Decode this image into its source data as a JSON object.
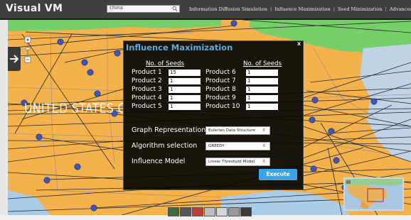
{
  "app": {
    "title": "Visual VM"
  },
  "search": {
    "value": "china"
  },
  "nav": {
    "items": [
      "Information Diffusion Simulation",
      "Influence Maximization",
      "Seed Minimization",
      "Advanced Search",
      ">"
    ]
  },
  "map": {
    "watermark": "UNITED STATES OF"
  },
  "modal": {
    "title": "Influence Maximization",
    "close": "x",
    "seeds_header": "No. of Seeds",
    "products_left": [
      {
        "label": "Product 1",
        "value": "15"
      },
      {
        "label": "Product 2",
        "value": "1"
      },
      {
        "label": "Product 3",
        "value": "1"
      },
      {
        "label": "Product 4",
        "value": "1"
      },
      {
        "label": "Product 5",
        "value": "1"
      }
    ],
    "products_right": [
      {
        "label": "Product 6",
        "value": "1"
      },
      {
        "label": "Product 7",
        "value": "1"
      },
      {
        "label": "Product 8",
        "value": "1"
      },
      {
        "label": "Product 9",
        "value": "1"
      },
      {
        "label": "Product 10",
        "value": "1"
      }
    ],
    "graph_label": "Graph Representation",
    "graph_value": "Eulerian Data Structure",
    "algo_label": "Algorithm selection",
    "algo_value": "GREEDY",
    "model_label": "Influence Model",
    "model_value": "Linear Threshold Model",
    "execute": "Execute"
  },
  "colors": {
    "topbar": "#3f3f3f",
    "land": "#f4b24d",
    "canada": "#7ad06a",
    "water": "#a8cbe8",
    "accent": "#3ca4e6",
    "title": "#5fa8dd",
    "node": "#3f55b8"
  }
}
